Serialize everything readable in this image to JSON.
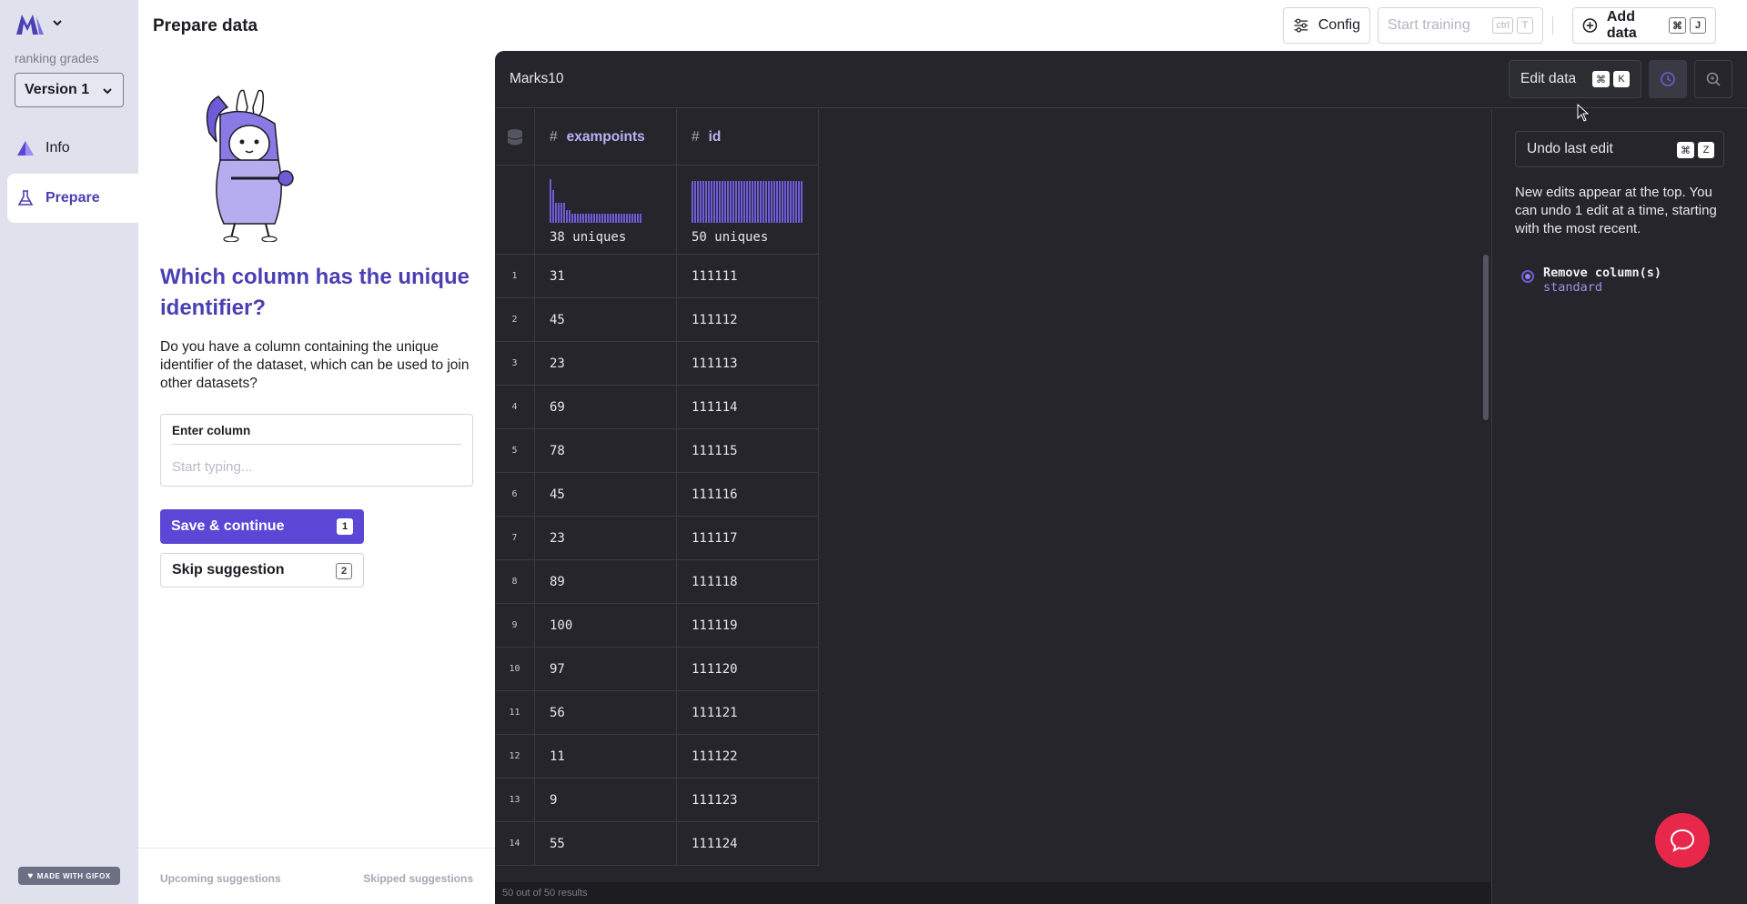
{
  "sidebar": {
    "project_name": "ranking grades",
    "version": "Version 1",
    "nav": [
      {
        "label": "Info",
        "icon": "triangle-logo-icon"
      },
      {
        "label": "Prepare",
        "icon": "flask-icon"
      }
    ],
    "gifox_label": "MADE WITH GIFOX"
  },
  "header": {
    "title": "Prepare data",
    "config_label": "Config",
    "start_training_label": "Start training",
    "start_training_keys": [
      "ctrl",
      "T"
    ],
    "add_data_label": "Add data",
    "add_data_keys": [
      "⌘",
      "J"
    ]
  },
  "panel": {
    "question": "Which column has the unique identifier?",
    "description": "Do you have a column containing the unique identifier of the dataset, which can be used to join other datasets?",
    "input_label": "Enter column",
    "input_placeholder": "Start typing...",
    "input_value": "",
    "save_label": "Save & continue",
    "save_key": "1",
    "skip_label": "Skip suggestion",
    "skip_key": "2",
    "upcoming_label": "Upcoming suggestions",
    "skipped_label": "Skipped suggestions"
  },
  "dataset": {
    "name": "Marks10",
    "edit_label": "Edit data",
    "edit_keys": [
      "⌘",
      "K"
    ],
    "columns": [
      {
        "type_icon": "#",
        "name": "exampoints",
        "uniques": "38 uniques"
      },
      {
        "type_icon": "#",
        "name": "id",
        "uniques": "50 uniques"
      }
    ],
    "rows": [
      {
        "n": "1",
        "exampoints": "31",
        "id": "111111"
      },
      {
        "n": "2",
        "exampoints": "45",
        "id": "111112"
      },
      {
        "n": "3",
        "exampoints": "23",
        "id": "111113"
      },
      {
        "n": "4",
        "exampoints": "69",
        "id": "111114"
      },
      {
        "n": "5",
        "exampoints": "78",
        "id": "111115"
      },
      {
        "n": "6",
        "exampoints": "45",
        "id": "111116"
      },
      {
        "n": "7",
        "exampoints": "23",
        "id": "111117"
      },
      {
        "n": "8",
        "exampoints": "89",
        "id": "111118"
      },
      {
        "n": "9",
        "exampoints": "100",
        "id": "111119"
      },
      {
        "n": "10",
        "exampoints": "97",
        "id": "111120"
      },
      {
        "n": "11",
        "exampoints": "56",
        "id": "111121"
      },
      {
        "n": "12",
        "exampoints": "11",
        "id": "111122"
      },
      {
        "n": "13",
        "exampoints": "9",
        "id": "111123"
      },
      {
        "n": "14",
        "exampoints": "55",
        "id": "111124"
      }
    ],
    "status": "50 out of 50 results"
  },
  "edits": {
    "undo_label": "Undo last edit",
    "undo_keys": [
      "⌘",
      "Z"
    ],
    "note": "New edits appear at the top. You can undo 1 edit at a time, starting with the most recent.",
    "items": [
      {
        "title": "Remove column(s)",
        "sub": "standard"
      }
    ]
  },
  "colors": {
    "accent": "#5b47d6",
    "accent_text": "#4a3fb3",
    "dark_bg": "#25252b",
    "chat": "#e8284b"
  }
}
